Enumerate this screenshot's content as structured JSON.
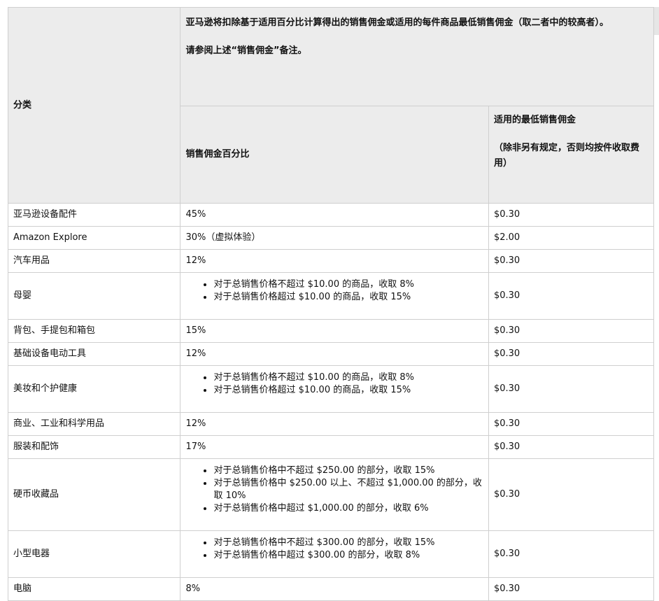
{
  "header": {
    "category_label": "分类",
    "rule_line1": "亚马逊将扣除基于适用百分比计算得出的销售佣金或适用的每件商品最低销售佣金（取二者中的较高者）。",
    "rule_line2": "请参阅上述“销售佣金”备注。",
    "percent_label": "销售佣金百分比",
    "min_label": "适用的最低销售佣金",
    "min_note": "（除非另有规定，否则均按件收取费用）"
  },
  "rows": [
    {
      "category": "亚马逊设备配件",
      "percent": "45%",
      "min": "$0.30"
    },
    {
      "category": "Amazon Explore",
      "percent": "30%（虚拟体验）",
      "min": "$2.00"
    },
    {
      "category": "汽车用品",
      "percent": "12%",
      "min": "$0.30"
    },
    {
      "category": "母婴",
      "tiers": [
        "对于总销售价格不超过 $10.00 的商品，收取 8%",
        "对于总销售价格超过 $10.00 的商品，收取 15%"
      ],
      "min": "$0.30"
    },
    {
      "category": "背包、手提包和箱包",
      "percent": "15%",
      "min": "$0.30"
    },
    {
      "category": "基础设备电动工具",
      "percent": "12%",
      "min": "$0.30"
    },
    {
      "category": "美妆和个护健康",
      "tiers": [
        "对于总销售价格不超过 $10.00 的商品，收取 8%",
        "对于总销售价格超过 $10.00 的商品，收取 15%"
      ],
      "min": "$0.30"
    },
    {
      "category": "商业、工业和科学用品",
      "percent": "12%",
      "min": "$0.30"
    },
    {
      "category": "服装和配饰",
      "percent": "17%",
      "min": "$0.30"
    },
    {
      "category": "硬币收藏品",
      "tiers": [
        "对于总销售价格中不超过 $250.00 的部分，收取 15%",
        "对于总销售价格中 $250.00 以上、不超过 $1,000.00 的部分，收取 10%",
        "对于总销售价格中超过 $1,000.00 的部分，收取 6%"
      ],
      "min": "$0.30"
    },
    {
      "category": "小型电器",
      "tiers": [
        "对于总销售价格中不超过 $300.00 的部分，收取 15%",
        "对于总销售价格中超过 $300.00 的部分，收取 8%"
      ],
      "min": "$0.30"
    },
    {
      "category": "电脑",
      "percent": "8%",
      "min": "$0.30"
    }
  ]
}
